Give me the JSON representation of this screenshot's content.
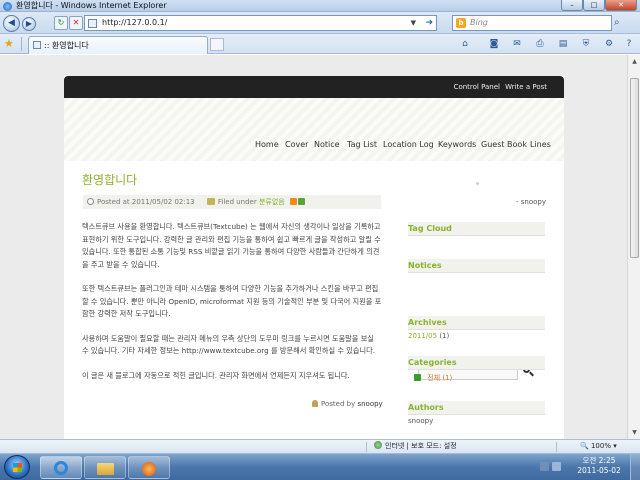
{
  "window": {
    "title": "환영합니다 - Windows Internet Explorer",
    "minimize_glyph": "–",
    "maximize_glyph": "□",
    "close_glyph": "✕"
  },
  "address": {
    "url": "http://127.0.0.1/",
    "search_placeholder": "Bing"
  },
  "tab": {
    "label": ":: 환영합니다"
  },
  "blog": {
    "top_links": {
      "control_panel": "Control Panel",
      "write_post": "Write a Post"
    },
    "nav": [
      "Home",
      "Cover",
      "Notice",
      "Tag List",
      "Location Log",
      "Keywords",
      "Guest Book",
      "Lines"
    ],
    "post": {
      "title": "환영합니다",
      "posted_at": "Posted at 2011/05/02 02:13",
      "filed_under": "Filed under",
      "category": "분류없음",
      "paragraphs": [
        "텍스트큐브 사용을 환영합니다. 텍스트큐브(Textcube) 는 웹에서 자신의 생각이나 일상을 기록하고 표현하기 위한 도구입니다. 강력한 글 관리와 편집 기능을 통하여 쉽고 빠르게 글을 작성하고 알릴 수 있습니다. 또한 통합된 소통 기능및 RSS 비깥글 읽기 기능을 통하여 다양한 사람들과 간단하게 의견을 주고 받을 수 있습니다.",
        "또한 텍스트큐브는 플러그인과 테마 시스템을 통하여 다양한 기능을 추가하거나 스킨을 바꾸고 편집할 수 있습니다. 뿐만 아니라 OpenID, microformat 지원 등의 기술적인 부분 및 다국어 지원을 포함한 강력한 저작 도구입니다.",
        "사용하며 도움말이 필요할 때는 관리자 메뉴의 우측 상단의 도우미 링크를 누르시면 도움말을 보실 수 있습니다. 기타 자세한 정보는 http://www.textcube.org 를 방문해서 확인하실 수 있습니다.",
        "이 글은 새 블로그에 자동으로 적힌 글입니다. 관리자 화면에서 언제든지 지우셔도 됩니다."
      ],
      "posted_by_label": "Posted by",
      "author": "snoopy"
    },
    "sidebar": {
      "blogger": "- snoopy",
      "tag_cloud": "Tag Cloud",
      "notices": "Notices",
      "archives": "Archives",
      "archive_month": "2011/05",
      "archive_count": "(1)",
      "categories": "Categories",
      "category_name": "전체",
      "category_count": "(1)",
      "authors": "Authors",
      "author_name": "snoopy"
    }
  },
  "status": {
    "zone": "인터넷 | 보호 모드: 설정",
    "zoom": "100%"
  },
  "taskbar": {
    "time": "오전 2:25",
    "date": "2011-05-02"
  },
  "colors": {
    "accent": "#8ab32c",
    "dark_bar": "#222222",
    "page_bg": "#ebebeb"
  }
}
